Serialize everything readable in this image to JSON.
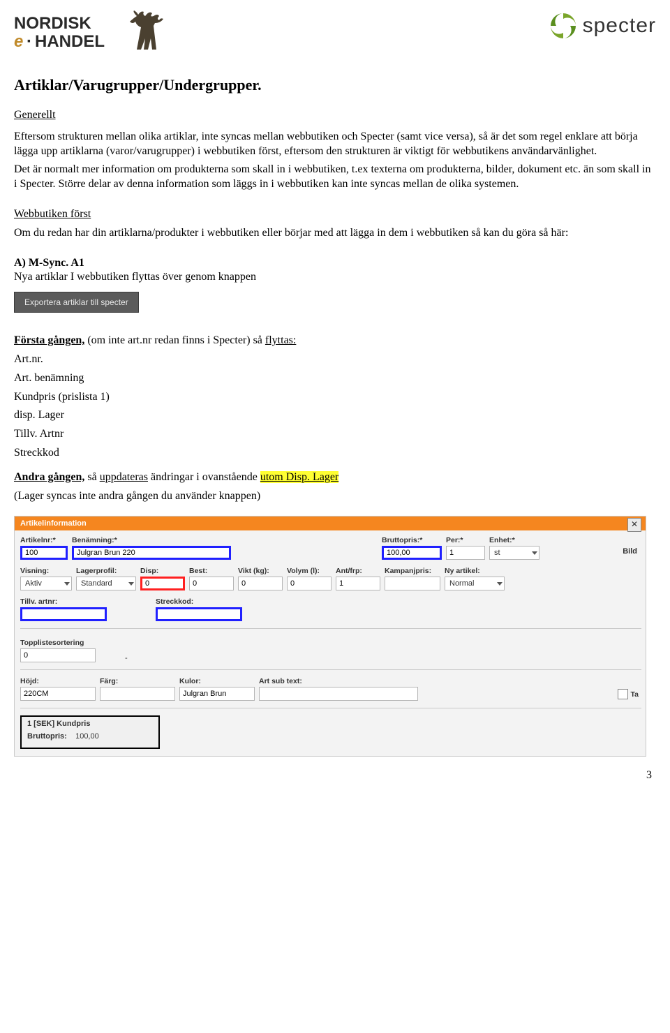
{
  "logos": {
    "left_line1": "NORDISK",
    "left_line2a": "e",
    "left_line2b": "HANDEL",
    "right": "specter"
  },
  "title": "Artiklar/Varugrupper/Undergrupper.",
  "section_generellt_heading": "Generellt",
  "generellt_p1": "Eftersom strukturen mellan olika artiklar, inte syncas mellan webbutiken och Specter (samt vice versa), så är det som regel enklare att börja lägga upp artiklarna (varor/varugrupper) i webbutiken först, eftersom den strukturen är viktigt för webbutikens användarvänlighet.",
  "generellt_p2": "Det är normalt mer information om produkterna som skall in i webbutiken, t.ex texterna om produkterna, bilder, dokument etc. än som skall in i Specter. Större delar av denna information som läggs in i webbutiken kan inte syncas mellan de olika systemen.",
  "section_webbutiken_heading": "Webbutiken först",
  "webbutiken_p": "Om du redan har din artiklarna/produkter i webbutiken eller börjar med att lägga in dem i webbutiken så kan du göra så här:",
  "a1_heading": "A) M-Sync. A1",
  "a1_sub": "Nya artiklar I webbutiken flyttas över genom knappen",
  "grey_button_label": "Exportera artiklar till specter",
  "forsta_heading_part1": "Första gången,",
  "forsta_heading_part2": " (om inte art.nr redan finns i Specter) så ",
  "forsta_heading_part3": "flyttas:",
  "forsta_items": [
    "Art.nr.",
    "Art. benämning",
    "Kundpris (prislista 1)",
    "disp. Lager",
    "Tillv. Artnr",
    "Streckkod"
  ],
  "andra_part1": "Andra gången,",
  "andra_part2": " så ",
  "andra_part3": "uppdateras",
  "andra_part4": " ändringar i ovanstående ",
  "andra_highlight": "utom Disp. Lager ",
  "andra_line2": "(Lager syncas inte andra gången du använder knappen)",
  "ai": {
    "header": "Artikelinformation",
    "close": "✕",
    "bild_label": "Bild",
    "row1": {
      "artikelnr_label": "Artikelnr:*",
      "artikelnr_value": "100",
      "benamning_label": "Benämning:*",
      "benamning_value": "Julgran Brun 220",
      "bruttopris_label": "Bruttopris:*",
      "bruttopris_value": "100,00",
      "per_label": "Per:*",
      "per_value": "1",
      "enhet_label": "Enhet:*",
      "enhet_value": "st"
    },
    "row2": {
      "visning_label": "Visning:",
      "visning_value": "Aktiv",
      "lagerprofil_label": "Lagerprofil:",
      "lagerprofil_value": "Standard",
      "disp_label": "Disp:",
      "disp_value": "0",
      "best_label": "Best:",
      "best_value": "0",
      "vikt_label": "Vikt (kg):",
      "vikt_value": "0",
      "volym_label": "Volym (l):",
      "volym_value": "0",
      "antfrp_label": "Ant/frp:",
      "antfrp_value": "1",
      "kampanjpris_label": "Kampanjpris:",
      "kampanjpris_value": "",
      "nyartikel_label": "Ny artikel:",
      "nyartikel_value": "Normal"
    },
    "row3": {
      "tillv_label": "Tillv. artnr:",
      "tillv_value": "",
      "streckkod_label": "Streckkod:",
      "streckkod_value": ""
    },
    "topplist": {
      "label": "Topplistesortering",
      "value": "0",
      "dash": "-"
    },
    "row4": {
      "hojd_label": "Höjd:",
      "hojd_value": "220CM",
      "farg_label": "Färg:",
      "farg_value": "",
      "kulor_label": "Kulor:",
      "kulor_value": "Julgran Brun",
      "sub_label": "Art sub text:",
      "sub_value": "",
      "ta_label": "Ta"
    },
    "price": {
      "title": "1 [SEK] Kundpris",
      "line_label": "Bruttopris:",
      "line_value": "100,00"
    }
  },
  "page_number": "3"
}
